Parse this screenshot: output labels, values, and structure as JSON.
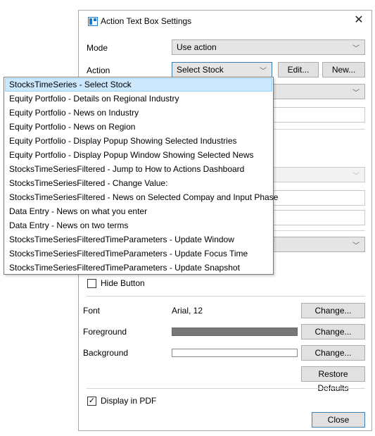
{
  "window": {
    "title": "Action Text Box Settings"
  },
  "colors": {
    "accent": "#1979ca",
    "foreground_swatch": "#777777",
    "background_swatch": "#ffffff",
    "selection": "#cce8ff"
  },
  "mode": {
    "label": "Mode",
    "value": "Use action"
  },
  "action": {
    "label": "Action",
    "value": "Select Stock",
    "edit_label": "Edit...",
    "new_label": "New..."
  },
  "options": {
    "hide_button": "Hide Button",
    "hide_button_checked": false
  },
  "font": {
    "label": "Font",
    "value": "Arial, 12",
    "change_label": "Change..."
  },
  "foreground": {
    "label": "Foreground",
    "change_label": "Change..."
  },
  "background": {
    "label": "Background",
    "change_label": "Change..."
  },
  "restore_label": "Restore Defaults",
  "pdf": {
    "label": "Display in PDF",
    "checked": true
  },
  "close_label": "Close",
  "dropdown_items": [
    "StocksTimeSeries - Select Stock",
    "Equity Portfolio - Details on Regional Industry",
    "Equity Portfolio - News on Industry",
    "Equity Portfolio - News on Region",
    "Equity Portfolio - Display Popup Showing Selected Industries",
    "Equity Portfolio - Display Popup Window Showing Selected News",
    "StocksTimeSeriesFiltered - Jump to How to Actions Dashboard",
    "StocksTimeSeriesFiltered - Change Value:",
    "StocksTimeSeriesFiltered - News on Selected Compay and Input Phase",
    "Data Entry - News on what you enter",
    "Data Entry - News on two terms",
    "StocksTimeSeriesFilteredTimeParameters - Update Window",
    "StocksTimeSeriesFilteredTimeParameters - Update Focus Time",
    "StocksTimeSeriesFilteredTimeParameters - Update Snapshot"
  ]
}
